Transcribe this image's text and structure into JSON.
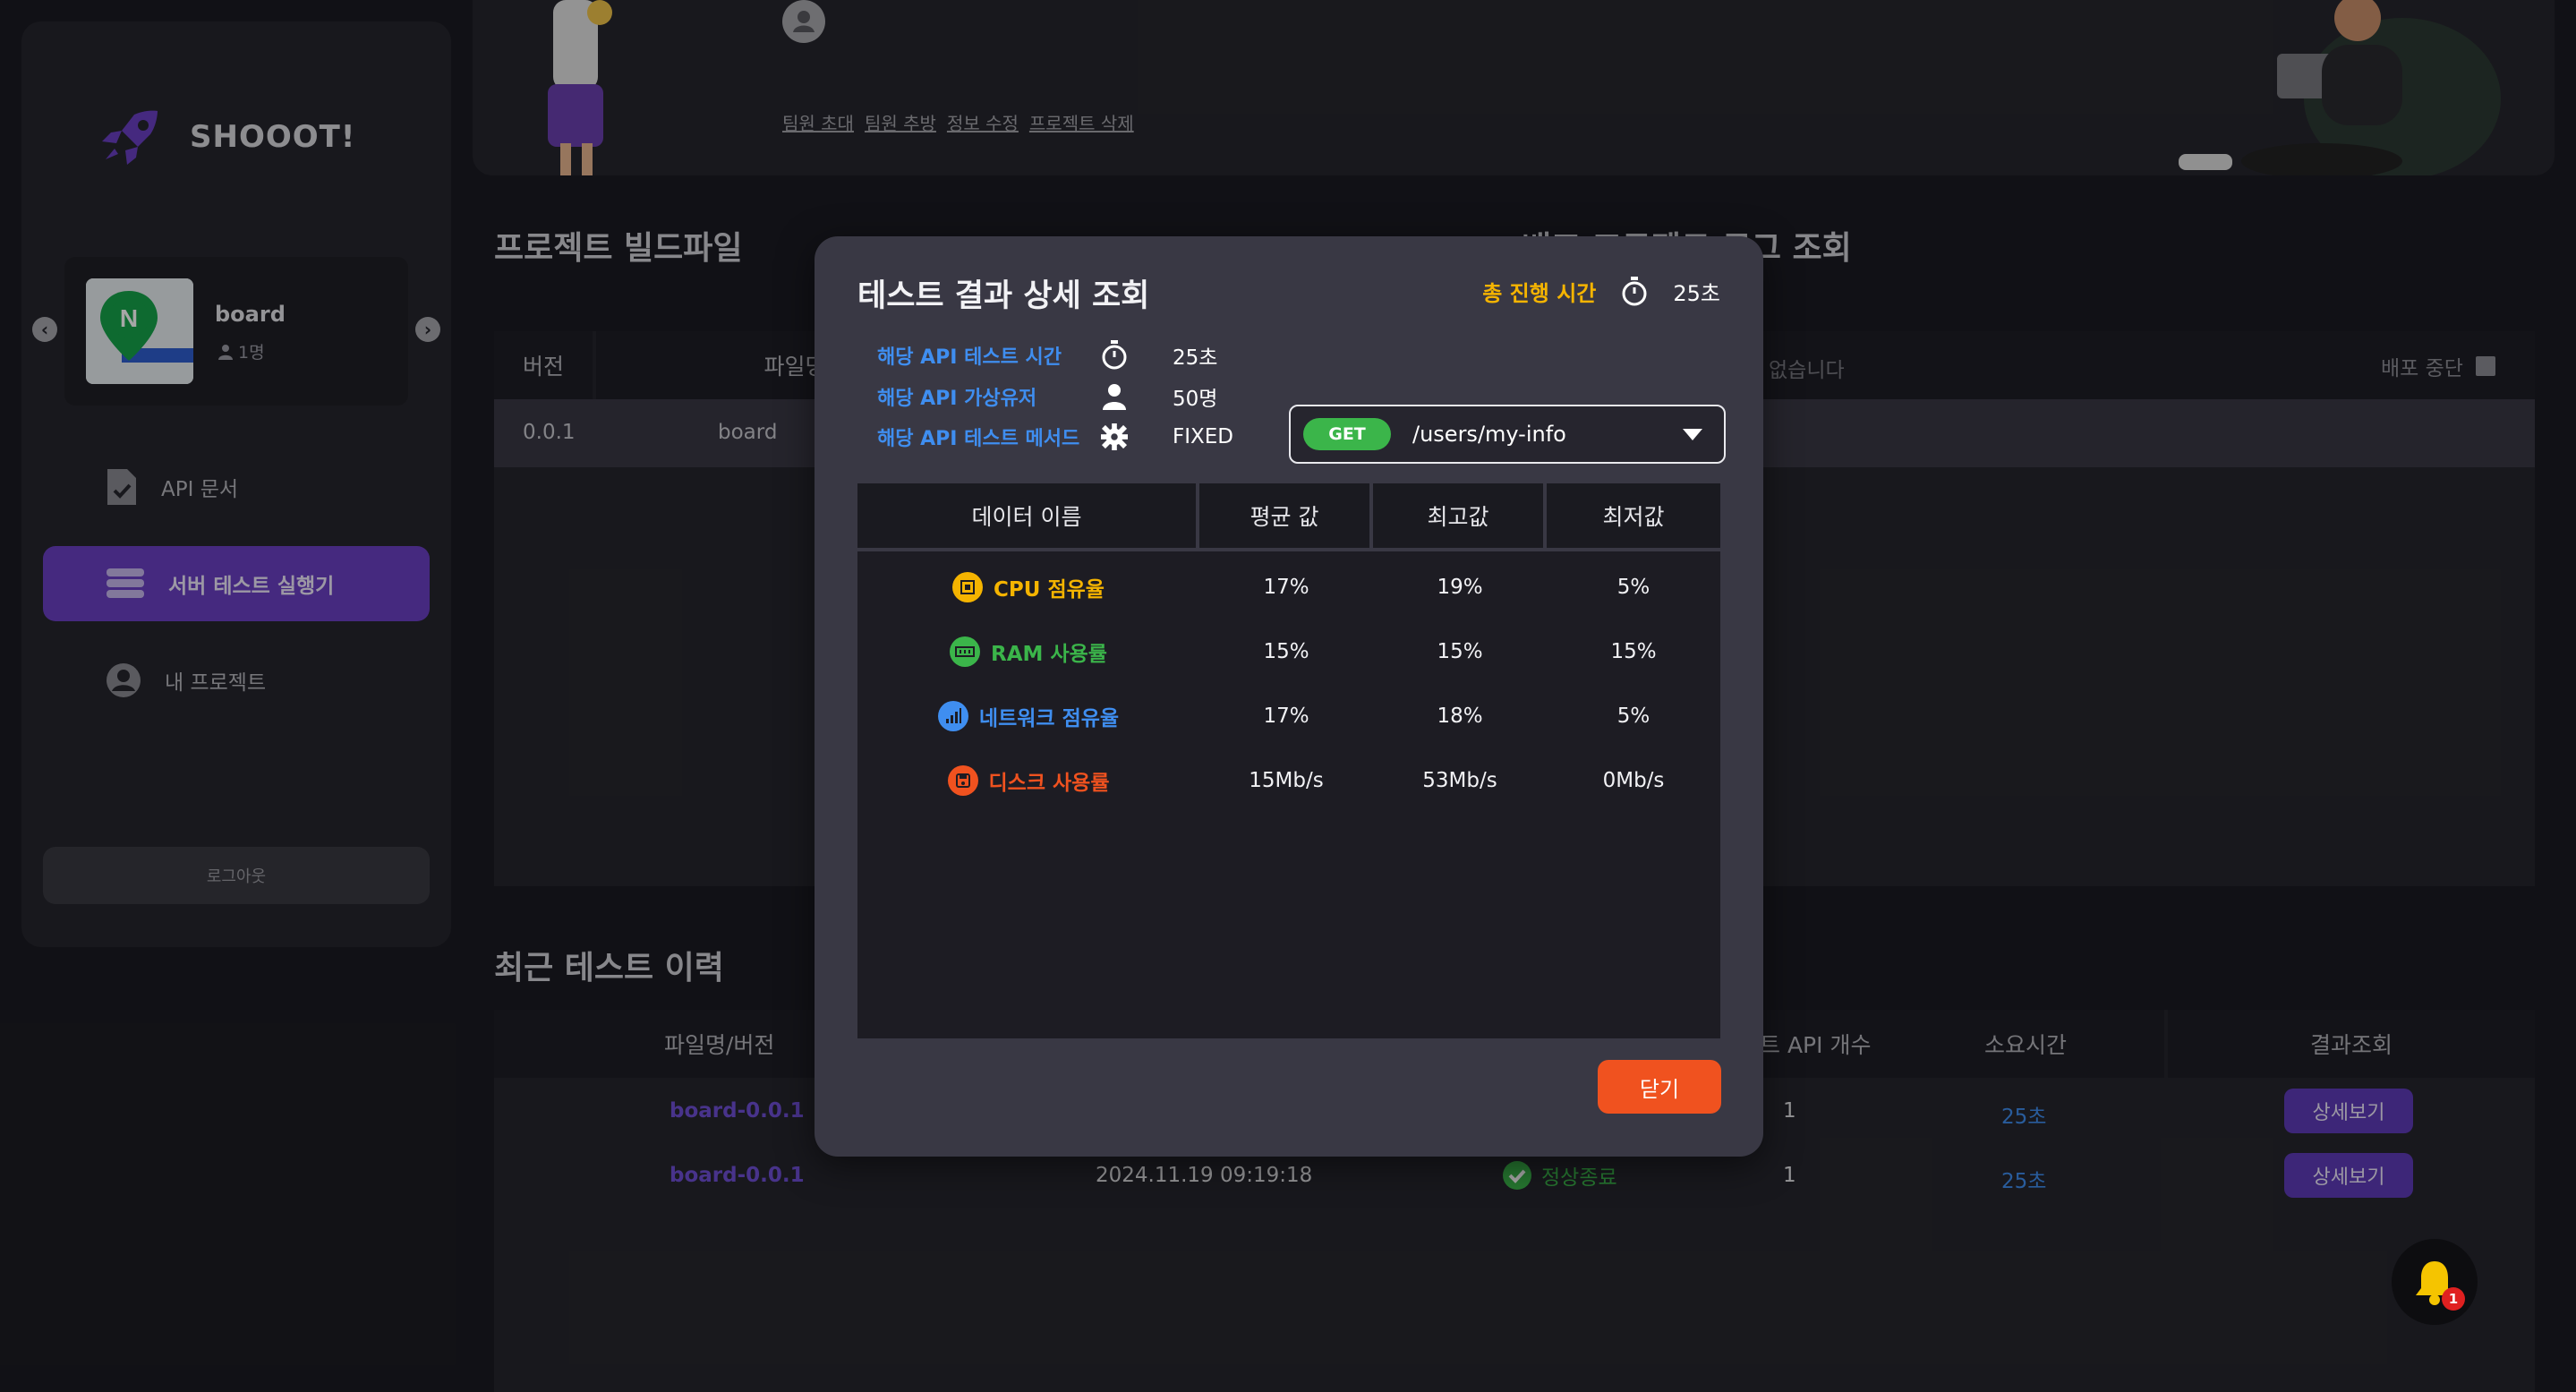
{
  "sidebar": {
    "brand": "SHOOOT!",
    "project": {
      "name": "board",
      "members": "1명",
      "thumb_letter": "N"
    },
    "nav": [
      {
        "label": "API 문서"
      },
      {
        "label": "서버 테스트 실행기"
      },
      {
        "label": "내 프로젝트"
      }
    ],
    "logout": "로그아웃"
  },
  "banner": {
    "links": [
      "팀원 초대",
      "팀원 추방",
      "정보 수정",
      "프로젝트 삭제"
    ]
  },
  "build": {
    "title": "프로젝트 빌드파일",
    "headers": [
      "버전",
      "파일명"
    ],
    "rows": [
      [
        "0.0.1",
        "board"
      ]
    ]
  },
  "deploy": {
    "title": "배포 프로젝트 로그 조회",
    "empty_text": "없습니다",
    "stop_label": "배포 중단"
  },
  "recent": {
    "title": "최근 테스트 이력",
    "headers": [
      "파일명/버전",
      "트 API 개수",
      "소요시간",
      "결과조회"
    ],
    "rows": [
      {
        "file": "board-0.0.1",
        "date": "",
        "status": "",
        "count": "1",
        "time": "25초",
        "action": "상세보기"
      },
      {
        "file": "board-0.0.1",
        "date": "2024.11.19 09:19:18",
        "status": "정상종료",
        "count": "1",
        "time": "25초",
        "action": "상세보기"
      }
    ]
  },
  "modal": {
    "title": "테스트 결과 상세 조회",
    "total_label": "총 진행 시간",
    "total_value": "25초",
    "info": [
      {
        "label": "해당 API 테스트 시간",
        "icon": "timer-icon",
        "value": "25초"
      },
      {
        "label": "해당 API 가상유저",
        "icon": "user-icon",
        "value": "50명"
      },
      {
        "label": "해당 API 테스트 메서드",
        "icon": "gear-icon",
        "value": "FIXED"
      }
    ],
    "select": {
      "method": "GET",
      "path": "/users/my-info"
    },
    "table": {
      "headers": [
        "데이터 이름",
        "평균 값",
        "최고값",
        "최저값"
      ],
      "rows": [
        {
          "name": "CPU 점유율",
          "color": "#f5b400",
          "icon": "cpu-icon",
          "avg": "17%",
          "max": "19%",
          "min": "5%"
        },
        {
          "name": "RAM 사용률",
          "color": "#3bb54a",
          "icon": "ram-icon",
          "avg": "15%",
          "max": "15%",
          "min": "15%"
        },
        {
          "name": "네트워크 점유율",
          "color": "#3f8ef0",
          "icon": "network-icon",
          "avg": "17%",
          "max": "18%",
          "min": "5%"
        },
        {
          "name": "디스크 사용률",
          "color": "#f0521f",
          "icon": "disk-icon",
          "avg": "15Mb/s",
          "max": "53Mb/s",
          "min": "0Mb/s"
        }
      ]
    },
    "close": "닫기"
  },
  "notifications": {
    "count": "1"
  }
}
